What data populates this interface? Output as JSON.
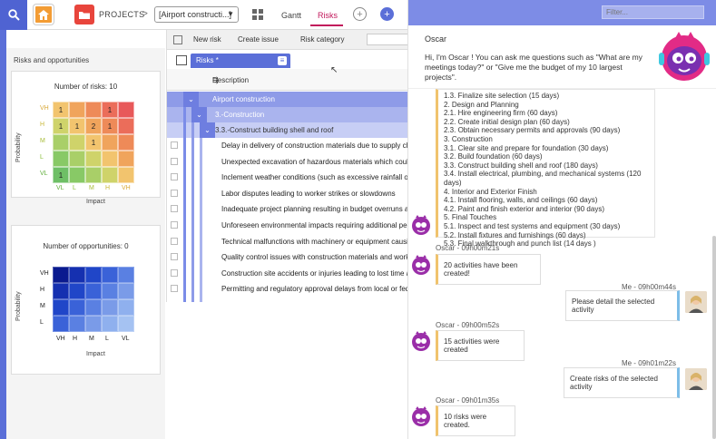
{
  "colors": {
    "accent": "#5b6fd8",
    "tab_active": "#c2185b",
    "home": "#f39c34",
    "projects": "#e8453c",
    "chat_accent": "#f0c36d",
    "me_accent": "#7dbde8"
  },
  "topbar": {
    "projects_label": "PROJECTS",
    "project_select": "[Airport constructi...]",
    "tab_gantt": "Gantt",
    "tab_risks": "Risks"
  },
  "risks_panel": {
    "title": "Risks and opportunities",
    "risks_chart": {
      "title": "Number of risks: 10",
      "y_label": "Probability",
      "x_label": "Impact",
      "y_ticks": [
        "VH",
        "H",
        "M",
        "L",
        "VL"
      ],
      "x_ticks": [
        "VL",
        "L",
        "M",
        "H",
        "VH"
      ],
      "cells": [
        [
          "1",
          "",
          "",
          "1",
          ""
        ],
        [
          "1",
          "1",
          "2",
          "1",
          ""
        ],
        [
          "",
          "",
          "1",
          "",
          ""
        ],
        [
          "",
          "",
          "",
          "",
          ""
        ],
        [
          "1",
          "",
          "",
          "",
          ""
        ]
      ]
    },
    "opps_chart": {
      "title": "Number of opportunities: 0",
      "y_label": "Probability",
      "x_label": "Impact",
      "y_ticks": [
        "VH",
        "H",
        "M",
        "L"
      ],
      "x_ticks": [
        "VH",
        "H",
        "M",
        "L",
        "VL"
      ]
    }
  },
  "mid": {
    "toolbar": {
      "new_risk": "New risk",
      "create_issue": "Create issue",
      "risk_category": "Risk category"
    },
    "tab": "Risks *",
    "col_description": "Description",
    "groups": [
      "Airport construction",
      "3.-Construction",
      "3.3.-Construct building shell and roof"
    ],
    "risks": [
      "Delay in delivery of construction materials due to supply chain",
      "Unexpected excavation of hazardous materials which could re",
      "Inclement weather conditions (such as excessive rainfall or sn",
      "Labor disputes leading to worker strikes or slowdowns",
      "Inadequate project planning resulting in budget overruns and",
      "Unforeseen environmental impacts requiring additional permi",
      "Technical malfunctions with machinery or equipment causing",
      "Quality control issues with construction materials and workm",
      "Construction site accidents or injuries leading to lost time an",
      "Permitting and regulatory approval delays from local or federa"
    ]
  },
  "chat": {
    "filter_placeholder": "Filter...",
    "bot_name": "Oscar",
    "intro": "Hi, I'm Oscar ! You can ask me questions such as \"What are my meetings today?\" or \"Give me the budget of my 10 largest projects\".",
    "plan_lines": [
      "1.3. Finalize site selection (15 days)",
      "2. Design and Planning",
      "2.1. Hire engineering firm (60 days)",
      "2.2. Create initial design plan (60 days)",
      "2.3. Obtain necessary permits and approvals (90 days)",
      "3. Construction",
      "3.1. Clear site and prepare for foundation (30 days)",
      "3.2. Build foundation (60 days)",
      "3.3. Construct building shell and roof (180 days)",
      "3.4. Install electrical, plumbing, and mechanical systems (120",
      "days)",
      "4. Interior and Exterior Finish",
      "4.1. Install flooring, walls, and ceilings (60 days)",
      "4.2. Paint and finish exterior and interior (90 days)",
      "5. Final Touches",
      "5.1. Inspect and test systems and equipment (30 days)",
      "5.2. Install fixtures and furnishings (60 days)",
      "5.3. Final walkthrough and punch list (14 days )"
    ],
    "messages": [
      {
        "meta": "Oscar - 09h00m21s",
        "text": "20 activities have been created!"
      },
      {
        "meta": "Me - 09h00m44s",
        "text": "Please detail the selected activity"
      },
      {
        "meta": "Oscar - 09h00m52s",
        "text": "15 activities were created"
      },
      {
        "meta": "Me - 09h01m22s",
        "text": "Create risks of the selected activity"
      },
      {
        "meta": "Oscar - 09h01m35s",
        "text": "10 risks were created."
      }
    ]
  }
}
